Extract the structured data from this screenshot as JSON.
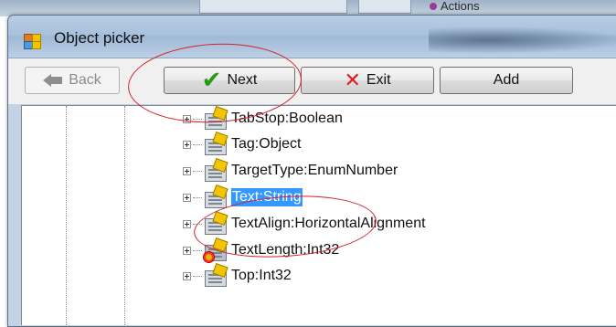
{
  "background": {
    "actions_text": "Actions"
  },
  "dialog": {
    "title": "Object picker",
    "toolbar": {
      "back_label": "Back",
      "next_label": "Next",
      "exit_label": "Exit",
      "add_label": "Add"
    },
    "tree": {
      "items": [
        {
          "label": "TabStop:Boolean",
          "icon": "property-icon",
          "selected": false
        },
        {
          "label": "Tag:Object",
          "icon": "property-icon",
          "selected": false
        },
        {
          "label": "TargetType:EnumNumber",
          "icon": "property-icon",
          "selected": false
        },
        {
          "label": "Text:String",
          "icon": "property-icon",
          "selected": true
        },
        {
          "label": "TextAlign:HorizontalAlignment",
          "icon": "property-icon",
          "selected": false
        },
        {
          "label": "TextLength:Int32",
          "icon": "readonly-property-icon",
          "selected": false
        },
        {
          "label": "Top:Int32",
          "icon": "property-icon",
          "selected": false
        }
      ]
    }
  },
  "colors": {
    "selection": "#3399ff",
    "annotation": "#d4202a",
    "check": "#2a9a12",
    "exit_x": "#e01c1c"
  }
}
